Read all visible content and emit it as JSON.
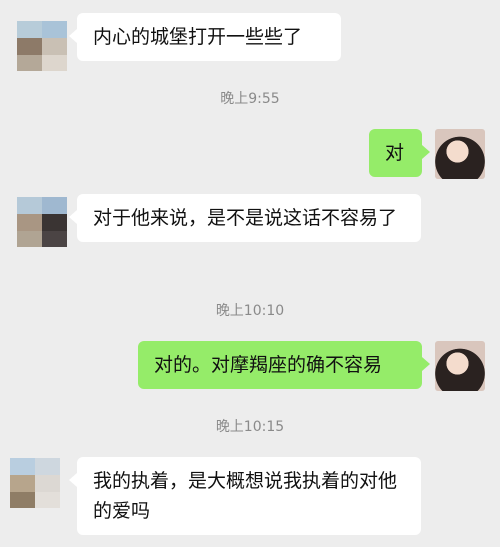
{
  "messages": [
    {
      "side": "left",
      "text": "内心的城堡打开一些些了"
    },
    {
      "time": "晚上9:55"
    },
    {
      "side": "right",
      "text": "对"
    },
    {
      "side": "left",
      "text": "对于他来说，是不是说这话不容易了"
    },
    {
      "time": "晚上10:10"
    },
    {
      "side": "right",
      "text": "对的。对摩羯座的确不容易"
    },
    {
      "time": "晚上10:15"
    },
    {
      "side": "left",
      "text": "我的执着，是大概想说我执着的对他的爱吗"
    }
  ],
  "colors": {
    "background": "#ededed",
    "incoming_bubble": "#ffffff",
    "outgoing_bubble": "#95ec69",
    "timestamp_text": "#8a8a8a"
  },
  "icons": {
    "contact_avatar": "pixelated-avatar-icon",
    "self_avatar": "user-photo-avatar-icon"
  }
}
